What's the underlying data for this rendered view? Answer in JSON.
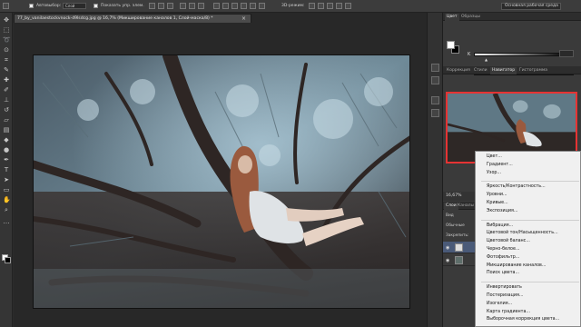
{
  "options_bar": {
    "autoselect_label": "Автовыбор:",
    "autoselect_value": "Слой",
    "show_controls_label": "Показать упр. элем."
  },
  "workspace": {
    "label": "Основная рабочая среда"
  },
  "document": {
    "tab_title": "77_by_vanilaestockvnock-d9lsdcg.jpg @ 16,7% (Микширование каналов 1, Слой-маска/8) *",
    "close_glyph": "×"
  },
  "panels": {
    "color_tabs": [
      "Цвет",
      "Образцы"
    ],
    "color_active": "Цвет",
    "k_label": "K",
    "k_value": "",
    "nav_tabs": [
      "Коррекция",
      "Стили",
      "Навигатор",
      "Гистограмма"
    ],
    "nav_active": "Навигатор",
    "zoom_value": "16,67%",
    "layers_tabs": [
      "Слои",
      "Каналы"
    ],
    "layers_kind": "Вид",
    "blend_mode": "Обычные",
    "lock_label": "Закрепить:"
  },
  "context_menu": {
    "items": [
      "Цвет...",
      "Градиент...",
      "Узор...",
      "---",
      "Яркость/Контрастность...",
      "Уровни...",
      "Кривые...",
      "Экспозиция...",
      "---",
      "Вибрация...",
      "Цветовой тон/Насыщенность...",
      "Цветовой баланс...",
      "Черно-белое...",
      "Фотофильтр...",
      "Микширование каналов...",
      "Поиск цвета...",
      "---",
      "Инвертировать",
      "Постеризация...",
      "Изогелия...",
      "Карта градиента...",
      "Выборочная коррекция цвета..."
    ]
  },
  "icons": {
    "tools": [
      "move-icon",
      "marquee-icon",
      "lasso-icon",
      "quick-select-icon",
      "crop-icon",
      "eyedropper-icon",
      "healing-icon",
      "brush-icon",
      "stamp-icon",
      "history-brush-icon",
      "eraser-icon",
      "gradient-icon",
      "blur-icon",
      "dodge-icon",
      "pen-icon",
      "type-icon",
      "path-select-icon",
      "shape-icon",
      "hand-icon",
      "zoom-icon"
    ]
  },
  "colors": {
    "accent_red": "#e53333",
    "menu_bg": "#f0f0f0"
  }
}
